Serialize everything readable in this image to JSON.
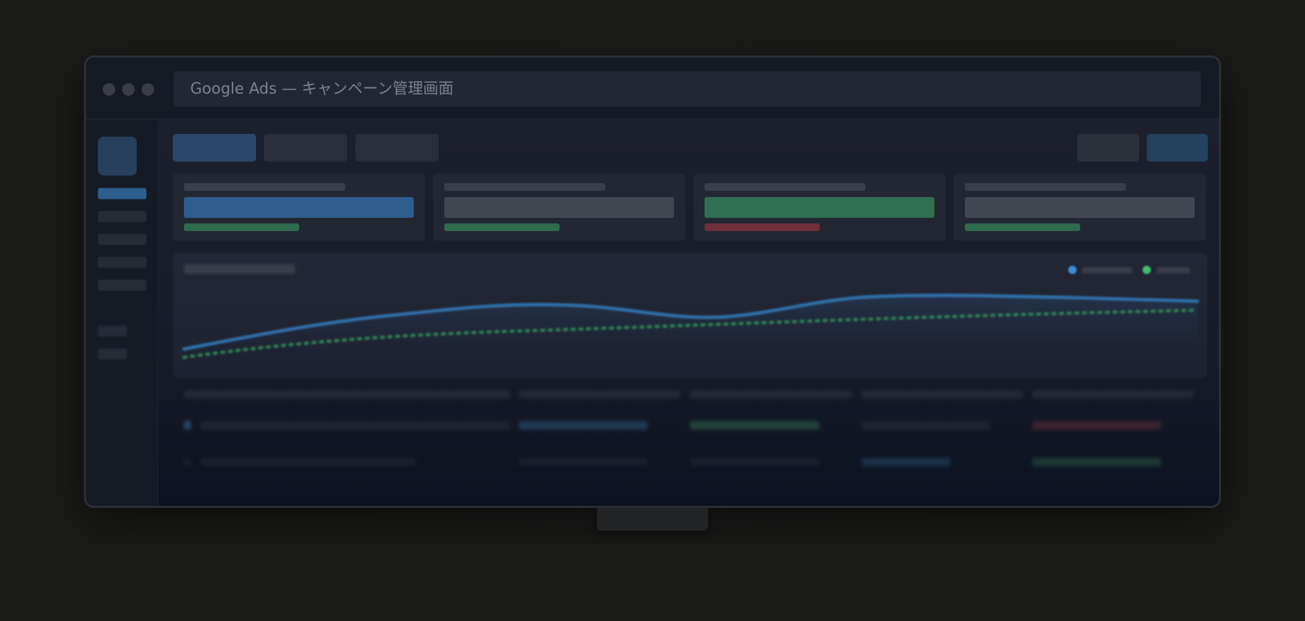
{
  "window": {
    "title": "Google Ads — キャンペーン管理画面"
  },
  "colors": {
    "accent_blue": "#2e5d8e",
    "positive_green": "#2f6b4e",
    "negative_red": "#6e2f3a",
    "line_blue": "#2f6fa8",
    "line_green": "#2d7a4f"
  },
  "icons": [
    "window-close-dot",
    "window-minimize-dot",
    "window-maximize-dot"
  ]
}
